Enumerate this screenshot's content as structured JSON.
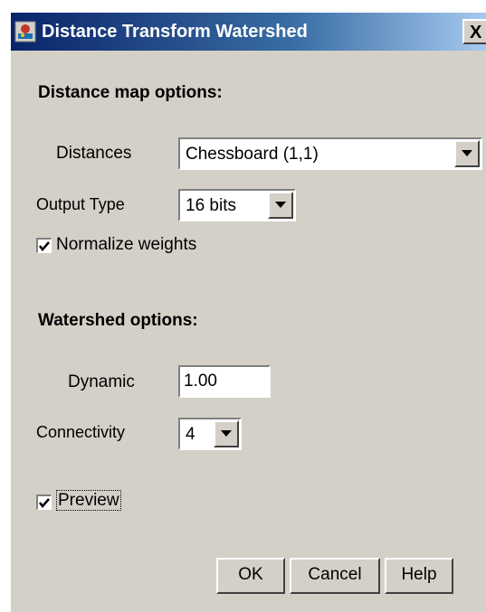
{
  "window": {
    "title": "Distance Transform Watershed",
    "close_glyph": "X",
    "app_icon": "imagej-icon"
  },
  "distance_map": {
    "heading": "Distance map options:",
    "distances_label": "Distances",
    "distances_value": "Chessboard (1,1)",
    "output_type_label": "Output Type",
    "output_type_value": "16 bits",
    "normalize_label": "Normalize weights",
    "normalize_checked": true
  },
  "watershed": {
    "heading": "Watershed options:",
    "dynamic_label": "Dynamic",
    "dynamic_value": "1.00",
    "connectivity_label": "Connectivity",
    "connectivity_value": "4"
  },
  "preview": {
    "label": "Preview",
    "checked": true
  },
  "buttons": {
    "ok": "OK",
    "cancel": "Cancel",
    "help": "Help"
  },
  "colors": {
    "dialog_bg": "#d4d0c8",
    "title_start": "#0a246a",
    "title_end": "#a6caf0"
  }
}
